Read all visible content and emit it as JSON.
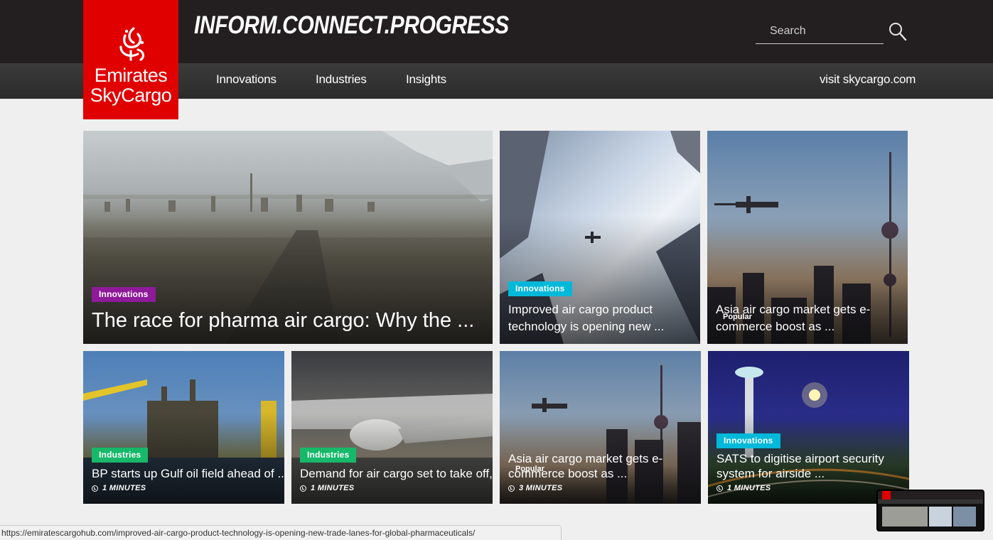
{
  "header": {
    "logo_line1": "Emirates",
    "logo_line2": "SkyCargo",
    "tagline": "INFORM.CONNECT.PROGRESS",
    "search_placeholder": "Search"
  },
  "nav": {
    "items": [
      "Innovations",
      "Industries",
      "Insights"
    ],
    "external_link": "visit skycargo.com"
  },
  "articles": [
    {
      "tag": "Innovations",
      "title": "The race for pharma air cargo: Why the ..."
    },
    {
      "tag": "Innovations",
      "title": "Improved air cargo product technology is opening new ..."
    },
    {
      "tag": "Popular",
      "title": "Asia air cargo market gets e-commerce boost as ..."
    },
    {
      "tag": "Industries",
      "title": "BP starts up Gulf oil field ahead of ...",
      "read_time": "1 MINUTES"
    },
    {
      "tag": "Industries",
      "title": "Demand for air cargo set to take off, ...",
      "read_time": "1 MINUTES"
    },
    {
      "tag": "Popular",
      "title": "Asia air cargo market gets e-commerce boost as ...",
      "read_time": "3 MINUTES"
    },
    {
      "tag": "Innovations",
      "title": "SATS to digitise airport security system for airside ...",
      "read_time": "1 MINUTES"
    }
  ],
  "status_url": "https://emiratescargohub.com/improved-air-cargo-product-technology-is-opening-new-trade-lanes-for-global-pharmaceuticals/",
  "colors": {
    "brand_red": "#e00000",
    "tag_innovations": "#00b8d9",
    "tag_innovations_featured": "#8e1a9a",
    "tag_industries": "#17b86a",
    "header_bg": "#231f20"
  }
}
